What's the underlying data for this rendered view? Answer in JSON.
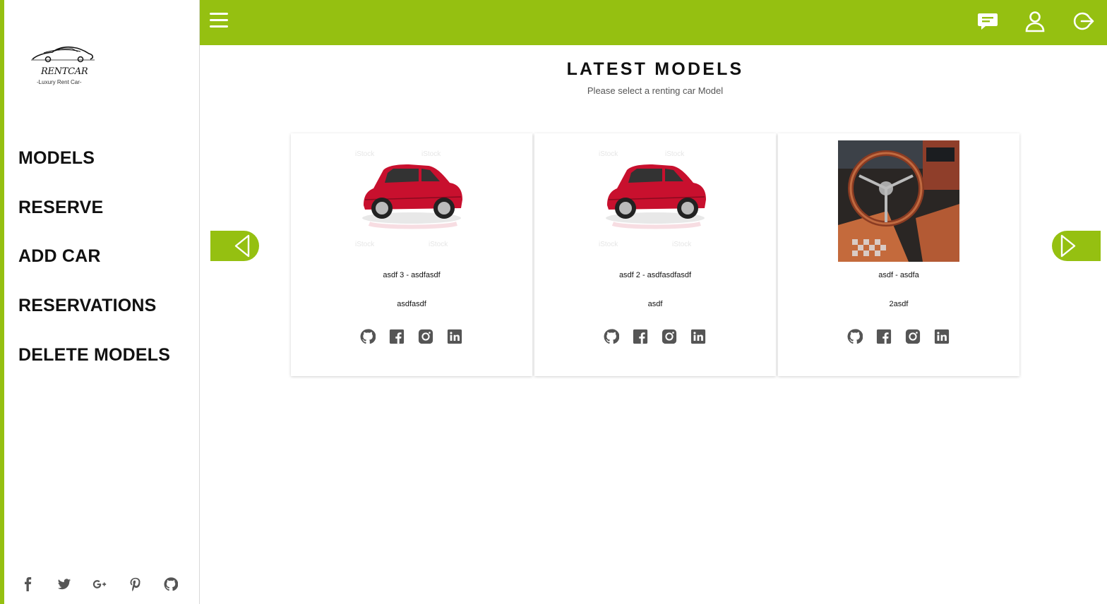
{
  "brand": {
    "name": "RENTCAR",
    "tagline": "-Luxury Rent Car-"
  },
  "colors": {
    "accent": "#95c011",
    "text": "#111111",
    "icon": "#555555"
  },
  "sidebar": {
    "nav": [
      {
        "label": "MODELS"
      },
      {
        "label": "RESERVE"
      },
      {
        "label": "ADD CAR"
      },
      {
        "label": "RESERVATIONS"
      },
      {
        "label": "DELETE MODELS"
      }
    ],
    "social": [
      "facebook-icon",
      "twitter-icon",
      "google-plus-icon",
      "pinterest-icon",
      "github-icon"
    ]
  },
  "topbar": {
    "icons": [
      "menu-icon",
      "chat-icon",
      "user-icon",
      "logout-icon"
    ]
  },
  "main": {
    "title": "LATEST MODELS",
    "subtitle": "Please select a renting car Model"
  },
  "cards": [
    {
      "name": "asdf 3 - asdfasdf",
      "description": "asdfasdf",
      "image": "red-suv"
    },
    {
      "name": "asdf 2 - asdfasdfasdf",
      "description": "asdf",
      "image": "red-suv"
    },
    {
      "name": "asdf - asdfa",
      "description": "2asdf",
      "image": "vintage-interior"
    }
  ],
  "card_social": [
    "github-icon",
    "facebook-icon",
    "instagram-icon",
    "linkedin-icon"
  ]
}
